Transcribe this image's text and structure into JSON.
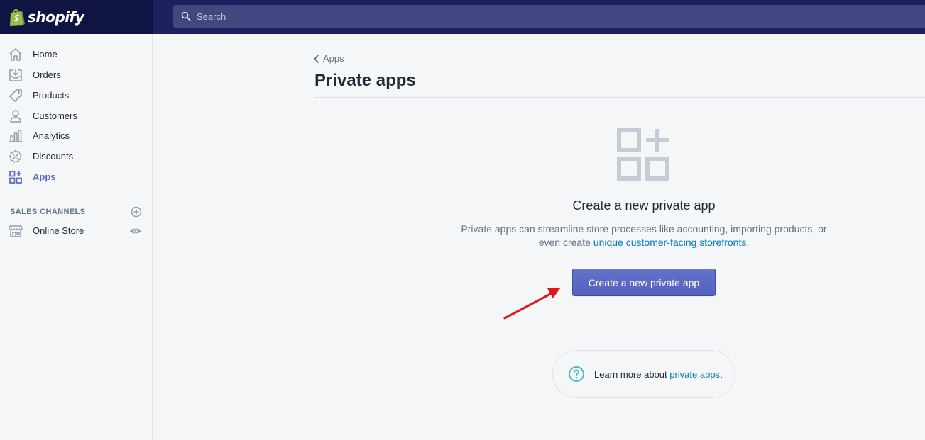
{
  "brand": {
    "name": "shopify"
  },
  "search": {
    "placeholder": "Search"
  },
  "sidebar": {
    "items": [
      {
        "label": "Home",
        "icon": "home-icon"
      },
      {
        "label": "Orders",
        "icon": "orders-icon"
      },
      {
        "label": "Products",
        "icon": "tag-icon"
      },
      {
        "label": "Customers",
        "icon": "person-icon"
      },
      {
        "label": "Analytics",
        "icon": "bar-chart-icon"
      },
      {
        "label": "Discounts",
        "icon": "discount-icon"
      },
      {
        "label": "Apps",
        "icon": "apps-icon",
        "active": true
      }
    ],
    "sales_channels": {
      "label": "SALES CHANNELS",
      "items": [
        {
          "label": "Online Store",
          "icon": "store-icon"
        }
      ]
    }
  },
  "breadcrumb": {
    "label": "Apps"
  },
  "page": {
    "title": "Private apps"
  },
  "empty_state": {
    "heading": "Create a new private app",
    "desc_prefix": "Private apps can streamline store processes like accounting, importing products, or even create ",
    "desc_link": "unique customer-facing storefronts",
    "desc_suffix": ".",
    "button_label": "Create a new private app"
  },
  "learn_more": {
    "prefix": "Learn more about ",
    "link": "private apps",
    "suffix": "."
  },
  "colors": {
    "topbar": "#1c2260",
    "logo_bg": "#0f1443",
    "accent": "#5c6ac4",
    "link": "#007ace",
    "help_teal": "#47c1bf",
    "arrow_red": "#e3161c"
  }
}
